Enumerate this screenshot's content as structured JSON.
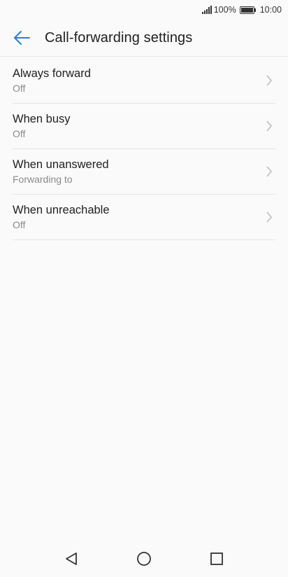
{
  "status_bar": {
    "battery": "100%",
    "time": "10:00",
    "icons": [
      "signal-icon",
      "battery-icon"
    ]
  },
  "header": {
    "title": "Call-forwarding settings",
    "back_icon": "back-arrow-icon"
  },
  "settings": {
    "items": [
      {
        "title": "Always forward",
        "subtitle": "Off"
      },
      {
        "title": "When busy",
        "subtitle": "Off"
      },
      {
        "title": "When unanswered",
        "subtitle": "Forwarding to"
      },
      {
        "title": "When unreachable",
        "subtitle": "Off"
      }
    ]
  },
  "nav_bar": {
    "icons": [
      "back-triangle-icon",
      "home-circle-icon",
      "recents-square-icon"
    ]
  },
  "colors": {
    "accent": "#2a7fd6",
    "background": "#fafafa",
    "divider": "#e4e4e4",
    "secondary_text": "#8a8a8a"
  }
}
